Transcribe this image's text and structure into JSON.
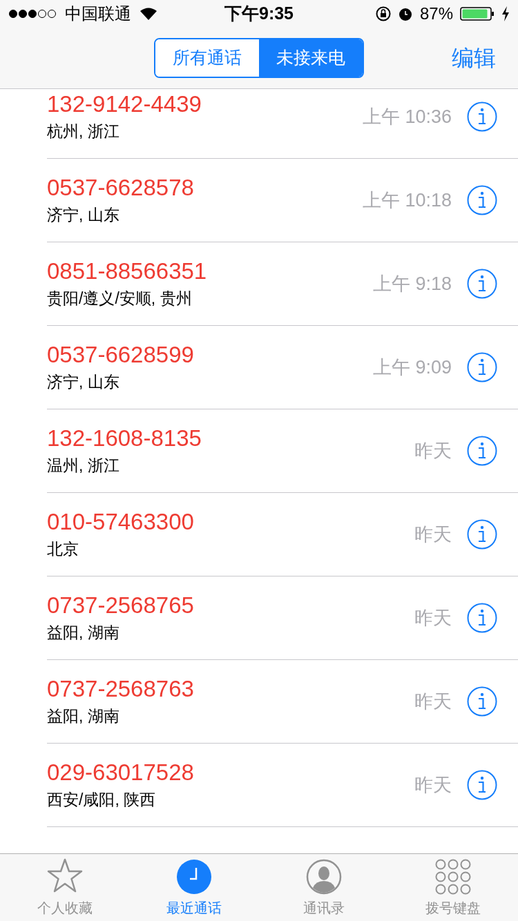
{
  "status_bar": {
    "carrier": "中国联通",
    "time": "下午9:35",
    "battery": "87%"
  },
  "nav": {
    "segments": [
      {
        "label": "所有通话",
        "selected": false
      },
      {
        "label": "未接来电",
        "selected": true
      }
    ],
    "edit": "编辑"
  },
  "calls": [
    {
      "number": "132-9142-4439",
      "location": "杭州, 浙江",
      "time": "上午 10:36"
    },
    {
      "number": "0537-6628578",
      "location": "济宁, 山东",
      "time": "上午 10:18"
    },
    {
      "number": "0851-88566351",
      "location": "贵阳/遵义/安顺, 贵州",
      "time": "上午 9:18"
    },
    {
      "number": "0537-6628599",
      "location": "济宁, 山东",
      "time": "上午 9:09"
    },
    {
      "number": "132-1608-8135",
      "location": "温州, 浙江",
      "time": "昨天"
    },
    {
      "number": "010-57463300",
      "location": "北京",
      "time": "昨天"
    },
    {
      "number": "0737-2568765",
      "location": "益阳, 湖南",
      "time": "昨天"
    },
    {
      "number": "0737-2568763",
      "location": "益阳, 湖南",
      "time": "昨天"
    },
    {
      "number": "029-63017528",
      "location": "西安/咸阳, 陕西",
      "time": "昨天"
    }
  ],
  "tab_bar": [
    {
      "kind": "favorites",
      "label": "个人收藏",
      "selected": false
    },
    {
      "kind": "recents",
      "label": "最近通话",
      "selected": true
    },
    {
      "kind": "contacts",
      "label": "通讯录",
      "selected": false
    },
    {
      "kind": "keypad",
      "label": "拨号键盘",
      "selected": false
    }
  ]
}
